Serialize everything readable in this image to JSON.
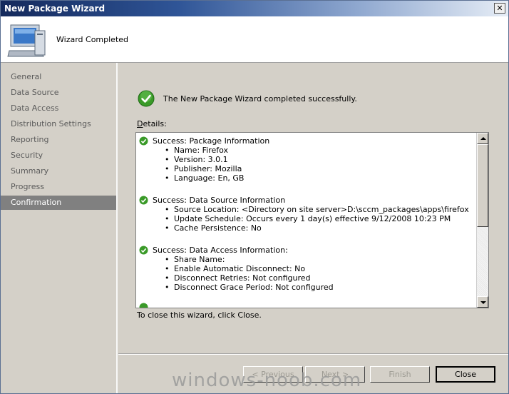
{
  "window": {
    "title": "New Package Wizard",
    "close_glyph": "✕"
  },
  "header": {
    "title": "Wizard Completed",
    "icon": "computer-icon"
  },
  "sidebar": {
    "items": [
      {
        "label": "General"
      },
      {
        "label": "Data Source"
      },
      {
        "label": "Data Access"
      },
      {
        "label": "Distribution Settings"
      },
      {
        "label": "Reporting"
      },
      {
        "label": "Security"
      },
      {
        "label": "Summary"
      },
      {
        "label": "Progress"
      },
      {
        "label": "Confirmation",
        "active": true
      }
    ]
  },
  "main": {
    "success_message": "The New Package Wizard completed successfully.",
    "details_label_access": "D",
    "details_label_rest": "etails:",
    "details": [
      {
        "title": "Success: Package Information",
        "items": [
          "Name: Firefox",
          "Version: 3.0.1",
          "Publisher: Mozilla",
          "Language: En, GB"
        ]
      },
      {
        "title": "Success: Data Source Information",
        "items": [
          "Source Location: <Directory on site server>D:\\sccm_packages\\apps\\firefox",
          "Update Schedule: Occurs every 1 day(s) effective 9/12/2008 10:23 PM",
          "Cache Persistence: No"
        ]
      },
      {
        "title": "Success: Data Access Information:",
        "items": [
          "Share Name:",
          "Enable Automatic Disconnect: No",
          "Disconnect Retries: Not configured",
          "Disconnect Grace Period: Not configured"
        ]
      }
    ],
    "close_hint": "To close this wizard, click Close."
  },
  "buttons": {
    "previous": "< Previous",
    "next": "Next >",
    "finish": "Finish",
    "close": "Close"
  },
  "watermark": "windows-noob.com",
  "colors": {
    "success_green": "#3a9a28",
    "active_nav": "#808080"
  }
}
